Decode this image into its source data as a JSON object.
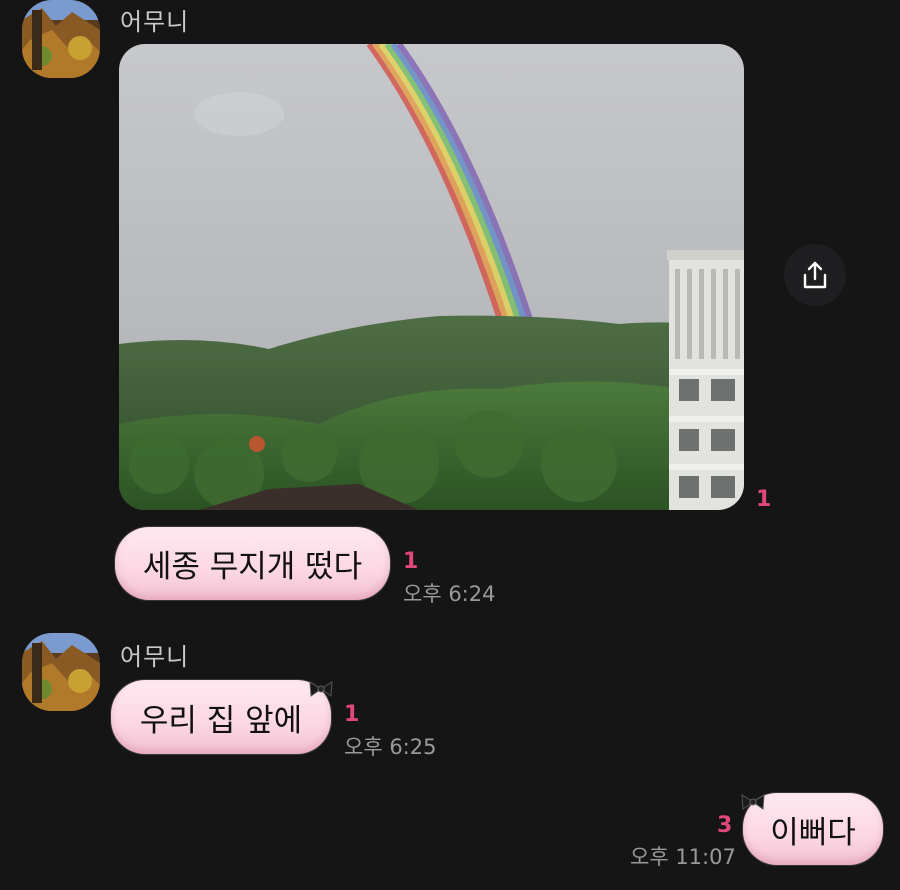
{
  "messages": [
    {
      "sender": "어무니",
      "unread": "1"
    },
    {
      "text": "세종 무지개 떴다",
      "unread": "1",
      "time": "오후 6:24"
    },
    {
      "sender": "어무니",
      "text": "우리 집 앞에",
      "unread": "1",
      "time": "오후 6:25"
    },
    {
      "text": "이뻐다",
      "unread": "3",
      "time": "오후 11:07"
    }
  ],
  "icons": {
    "share": "share-icon",
    "avatar": "avatar"
  },
  "colors": {
    "background": "#151516",
    "bubble": "#fcd7e3",
    "unread": "#e0477a",
    "time": "#9a9a9a"
  }
}
